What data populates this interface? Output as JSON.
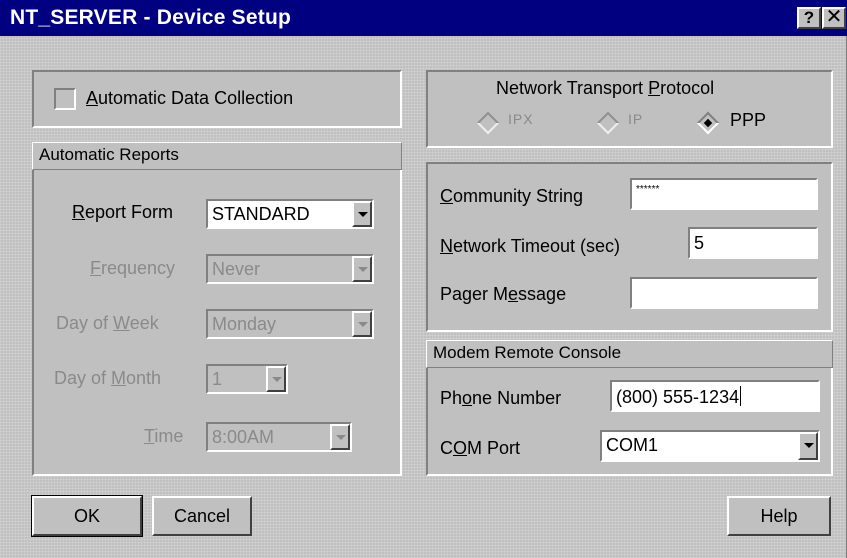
{
  "window": {
    "title": "NT_SERVER - Device Setup",
    "help_glyph": "?",
    "close_glyph": "✕"
  },
  "collection": {
    "checkbox_label": "Automatic Data Collection",
    "checked": false
  },
  "reports": {
    "header": "Automatic Reports",
    "report_form": {
      "label": "Report Form",
      "value": "STANDARD"
    },
    "frequency": {
      "label": "Frequency",
      "value": "Never"
    },
    "day_of_week": {
      "label": "Day of Week",
      "value": "Monday"
    },
    "day_of_month": {
      "label": "Day of Month",
      "value": "1"
    },
    "time": {
      "label": "Time",
      "value": "8:00AM"
    }
  },
  "protocol": {
    "header": "Network Transport Protocol",
    "options": [
      "IPX",
      "IP",
      "PPP"
    ],
    "selected": "PPP"
  },
  "snmp": {
    "community_string": {
      "label": "Community String",
      "value": "******"
    },
    "network_timeout": {
      "label": "Network Timeout (sec)",
      "value": "5"
    },
    "pager_message": {
      "label": "Pager Message",
      "value": ""
    }
  },
  "modem": {
    "header": "Modem Remote Console",
    "phone_number": {
      "label": "Phone Number",
      "value": "(800) 555-1234"
    },
    "com_port": {
      "label": "COM Port",
      "value": "COM1"
    }
  },
  "buttons": {
    "ok": "OK",
    "cancel": "Cancel",
    "help": "Help"
  }
}
